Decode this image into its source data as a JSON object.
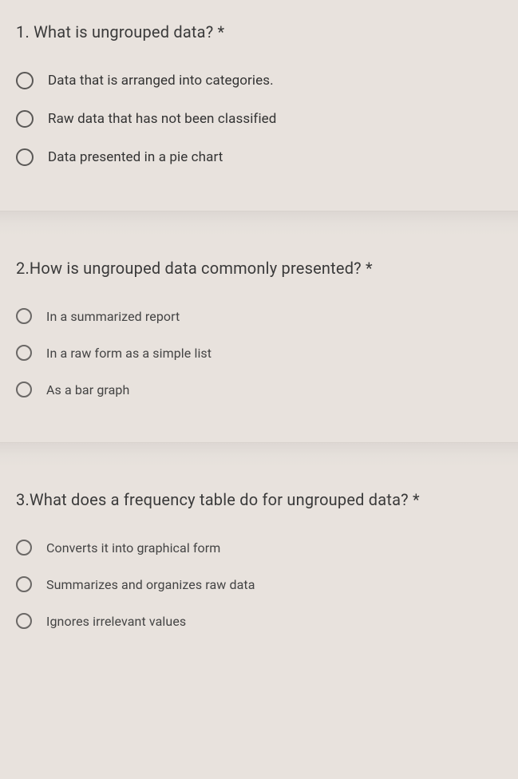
{
  "questions": [
    {
      "title": "1. What is ungrouped data? *",
      "options": [
        "Data that is arranged into categories.",
        "Raw data that has not been classified",
        "Data presented in a pie chart"
      ]
    },
    {
      "title": "2.How is ungrouped data commonly presented? *",
      "options": [
        "In a summarized report",
        "In a raw form as a simple list",
        "As a bar graph"
      ]
    },
    {
      "title": "3.What does a frequency table do for ungrouped data? *",
      "options": [
        "Converts it into graphical form",
        "Summarizes and organizes raw data",
        "Ignores irrelevant values"
      ]
    }
  ]
}
